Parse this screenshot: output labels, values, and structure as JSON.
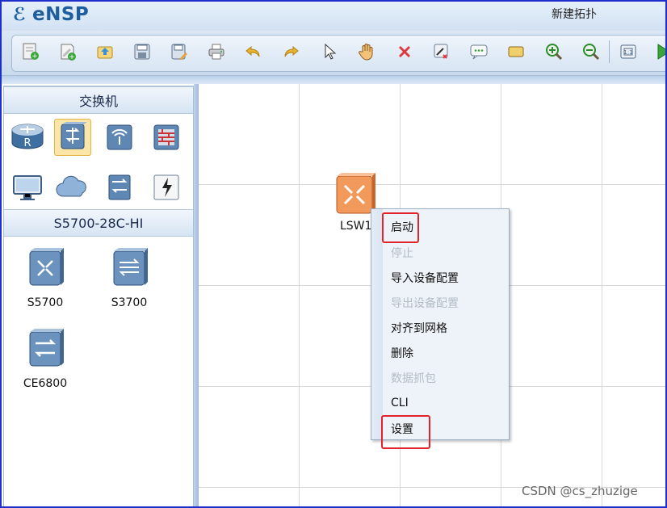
{
  "app": {
    "logo_text": "eNSP",
    "window_title": "新建拓扑"
  },
  "toolbar": {
    "buttons": [
      {
        "name": "new-topology-icon",
        "glyph": "▤"
      },
      {
        "name": "new-script-icon",
        "glyph": "✎"
      },
      {
        "name": "open-icon",
        "glyph": "⇧"
      },
      {
        "name": "save-icon",
        "glyph": "▣"
      },
      {
        "name": "save-as-icon",
        "glyph": "✐"
      },
      {
        "name": "print-icon",
        "glyph": "⎙"
      },
      {
        "name": "undo-icon",
        "glyph": "↶"
      },
      {
        "name": "redo-icon",
        "glyph": "↷"
      },
      {
        "name": "select-pointer-icon",
        "glyph": "➶"
      },
      {
        "name": "pan-hand-icon",
        "glyph": "✋"
      },
      {
        "name": "delete-icon",
        "glyph": "✖"
      },
      {
        "name": "delete-link-icon",
        "glyph": "✂"
      },
      {
        "name": "add-text-icon",
        "glyph": "…"
      },
      {
        "name": "add-shape-icon",
        "glyph": "▭"
      },
      {
        "name": "zoom-in-icon",
        "glyph": "+"
      },
      {
        "name": "zoom-out-icon",
        "glyph": "−"
      },
      {
        "name": "fit-view-icon",
        "glyph": "⊡"
      },
      {
        "name": "start-devices-icon",
        "glyph": "▶"
      }
    ]
  },
  "sidebar": {
    "category_title": "交换机",
    "model_title": "S5700-28C-HI",
    "categories": [
      {
        "name": "router-category-icon"
      },
      {
        "name": "switch-category-icon",
        "selected": true
      },
      {
        "name": "wlan-category-icon"
      },
      {
        "name": "firewall-category-icon"
      },
      {
        "name": "terminal-category-icon"
      },
      {
        "name": "cloud-category-icon"
      },
      {
        "name": "other-devices-category-icon"
      },
      {
        "name": "connection-category-icon"
      }
    ],
    "devices": [
      {
        "label": "S5700"
      },
      {
        "label": "S3700"
      },
      {
        "label": "CE6800"
      }
    ]
  },
  "canvas": {
    "node_label": "LSW1"
  },
  "context_menu": {
    "items": [
      {
        "label": "启动",
        "enabled": true,
        "highlighted": true
      },
      {
        "label": "停止",
        "enabled": false
      },
      {
        "label": "导入设备配置",
        "enabled": true
      },
      {
        "label": "导出设备配置",
        "enabled": false
      },
      {
        "label": "对齐到网格",
        "enabled": true
      },
      {
        "label": "删除",
        "enabled": true
      },
      {
        "label": "数据抓包",
        "enabled": false
      },
      {
        "label": "CLI",
        "enabled": true
      },
      {
        "label": "设置",
        "enabled": true,
        "highlighted": true
      }
    ]
  },
  "watermark": "CSDN @cs_zhuzige",
  "colors": {
    "highlight": "#e3232b",
    "accent": "#1d5e9e",
    "node": "#f08a4b"
  }
}
